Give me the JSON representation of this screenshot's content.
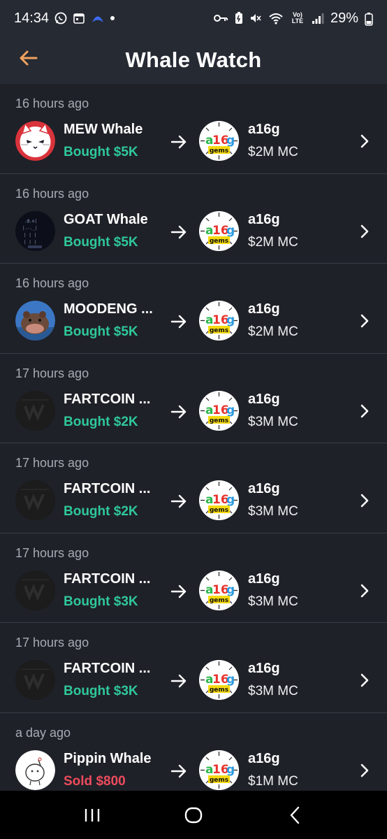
{
  "status": {
    "time": "14:34",
    "battery": "29%",
    "volte": "Vo)\nLTE"
  },
  "header": {
    "title": "Whale Watch",
    "accent_color": "#f0a35c"
  },
  "colors": {
    "bought": "#2fc89a",
    "sold": "#ec4b5c",
    "background": "#1f2128",
    "header_bg": "#262a33"
  },
  "items": [
    {
      "time": "16 hours ago",
      "whale": "MEW Whale",
      "action": "Bought $5K",
      "type": "bought",
      "avatar": "mew-cat-icon",
      "token": "a16g",
      "mc": "$2M MC"
    },
    {
      "time": "16 hours ago",
      "whale": "GOAT Whale",
      "action": "Bought $5K",
      "type": "bought",
      "avatar": "goat-terminal-icon",
      "token": "a16g",
      "mc": "$2M MC"
    },
    {
      "time": "16 hours ago",
      "whale": "MOODENG ...",
      "action": "Bought $5K",
      "type": "bought",
      "avatar": "moodeng-hippo-icon",
      "token": "a16g",
      "mc": "$2M MC"
    },
    {
      "time": "17 hours ago",
      "whale": "FARTCOIN ...",
      "action": "Bought $2K",
      "type": "bought",
      "avatar": "fartcoin-icon",
      "token": "a16g",
      "mc": "$3M MC"
    },
    {
      "time": "17 hours ago",
      "whale": "FARTCOIN ...",
      "action": "Bought $2K",
      "type": "bought",
      "avatar": "fartcoin-icon",
      "token": "a16g",
      "mc": "$3M MC"
    },
    {
      "time": "17 hours ago",
      "whale": "FARTCOIN ...",
      "action": "Bought $3K",
      "type": "bought",
      "avatar": "fartcoin-icon",
      "token": "a16g",
      "mc": "$3M MC"
    },
    {
      "time": "17 hours ago",
      "whale": "FARTCOIN ...",
      "action": "Bought $3K",
      "type": "bought",
      "avatar": "fartcoin-icon",
      "token": "a16g",
      "mc": "$3M MC"
    },
    {
      "time": "a day ago",
      "whale": "Pippin Whale",
      "action": "Sold $800",
      "type": "sold",
      "avatar": "pippin-unicorn-icon",
      "token": "a16g",
      "mc": "$1M MC"
    }
  ],
  "token_logo": {
    "line1": "a16g",
    "line2": "gems"
  }
}
